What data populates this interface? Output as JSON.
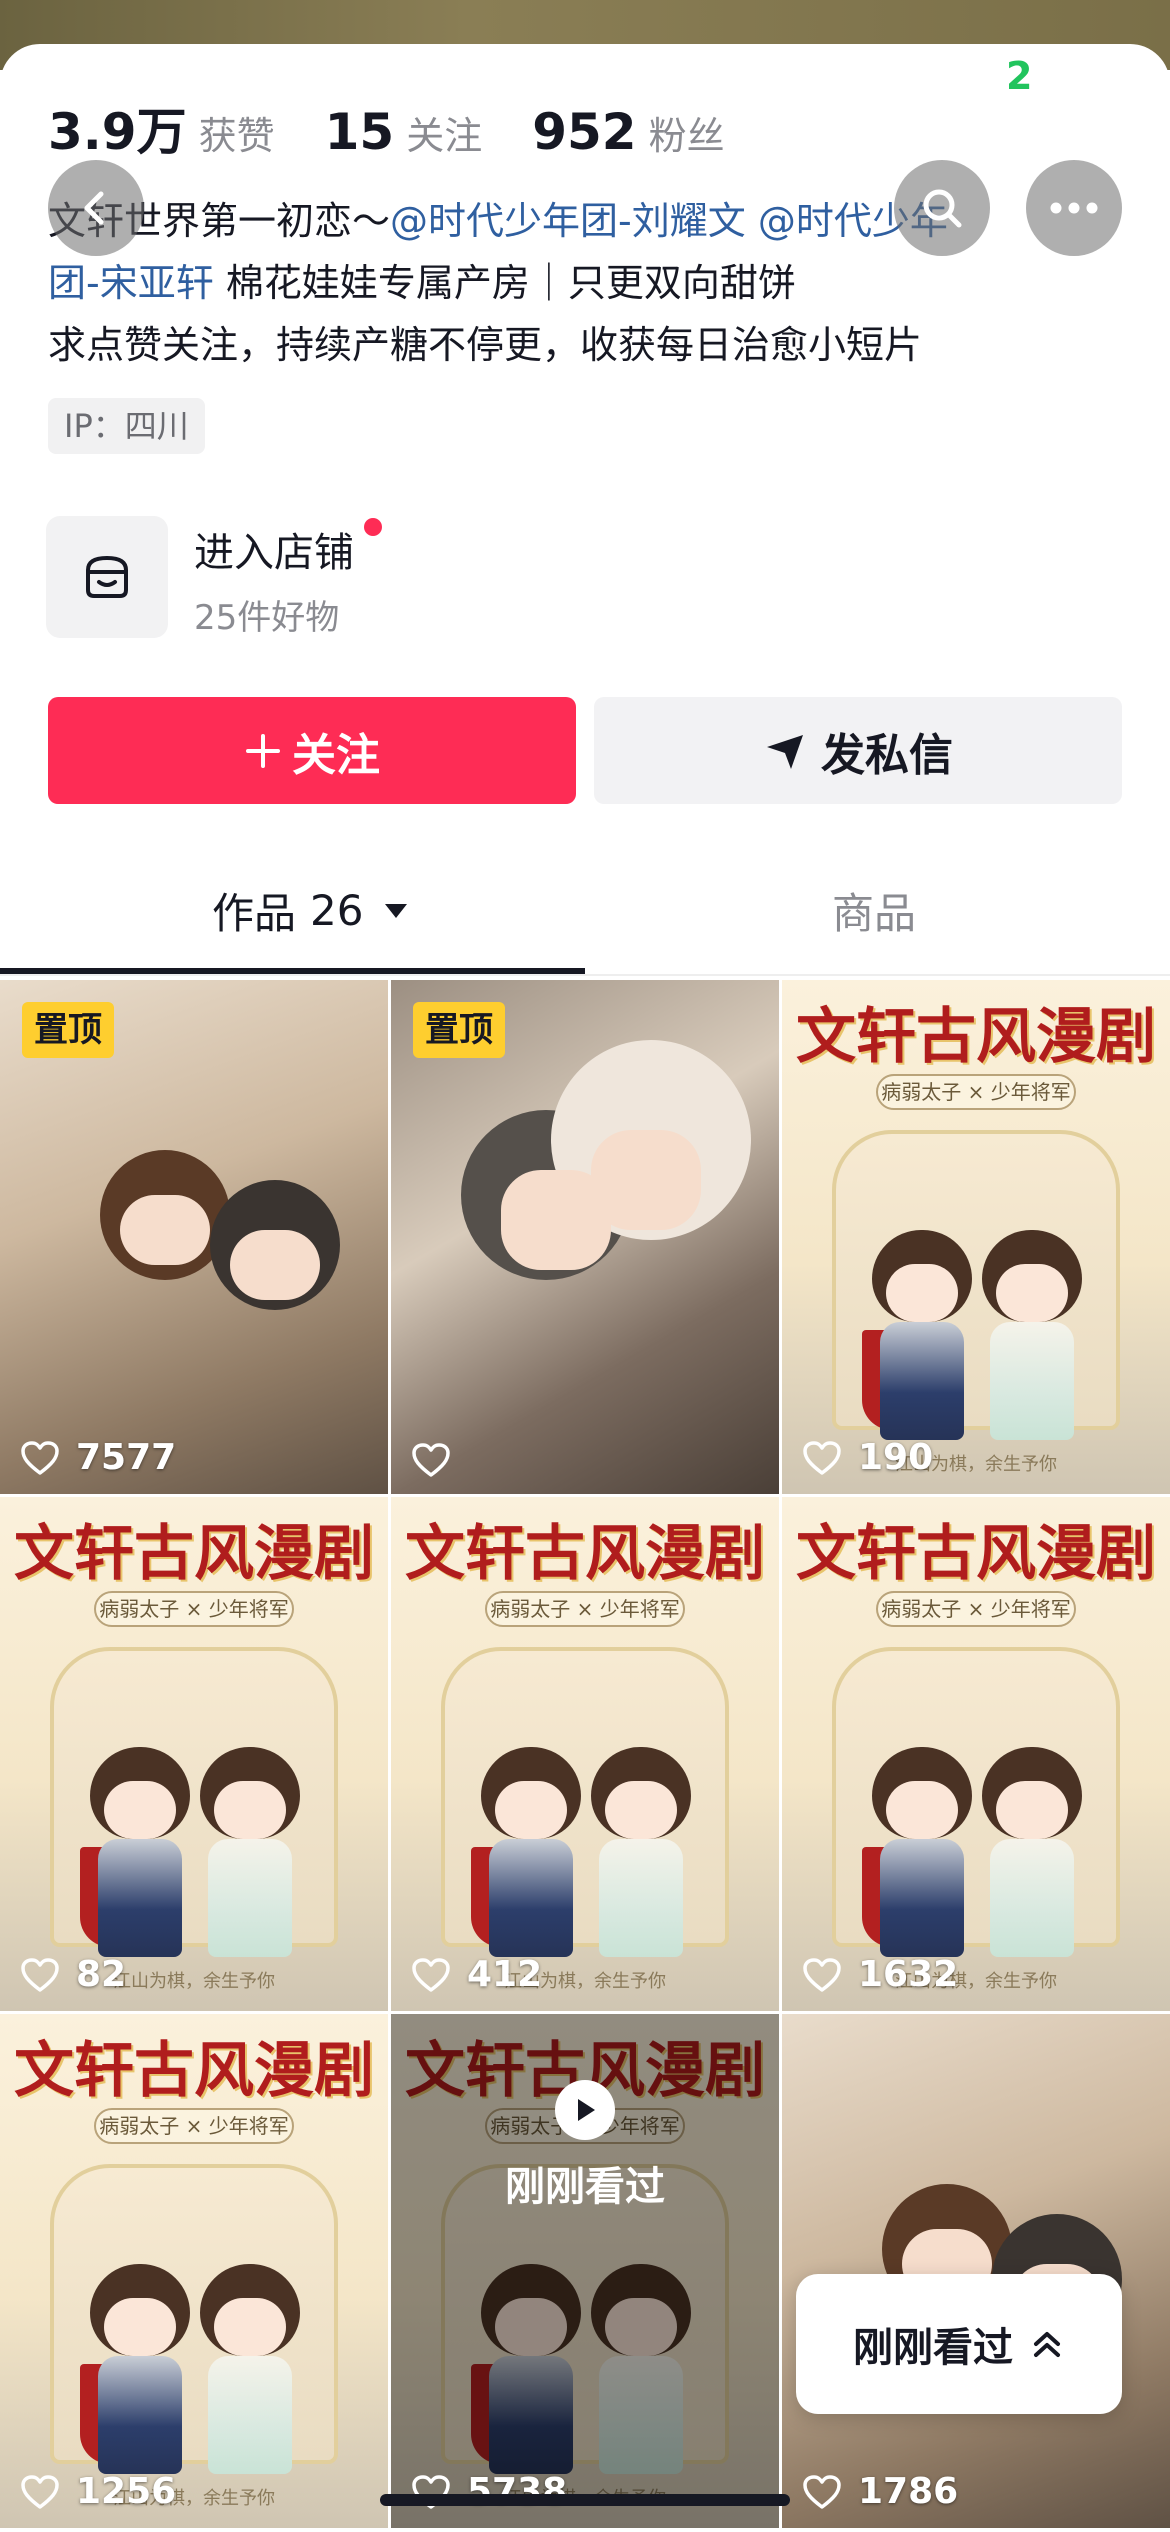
{
  "status": {
    "badge": "2"
  },
  "stats": [
    {
      "num": "3.9万",
      "label": "获赞"
    },
    {
      "num": "15",
      "label": "关注"
    },
    {
      "num": "952",
      "label": "粉丝"
    }
  ],
  "bio": {
    "line1_prefix": "文轩世界第一初恋～",
    "mention1": "@时代少年团-刘耀文",
    "mention2_a": "@时代少年",
    "mention2_b": "团-宋亚轩",
    "line2_rest": "棉花娃娃专属产房｜只更双向甜饼",
    "line3": "求点赞关注，持续产糖不停更，收获每日治愈小短片"
  },
  "ip": "IP：四川",
  "shop": {
    "title": "进入店铺",
    "subtitle": "25件好物"
  },
  "buttons": {
    "follow": "关注",
    "message": "发私信"
  },
  "tabs": {
    "works_label": "作品",
    "works_count": "26",
    "goods_label": "商品"
  },
  "poster": {
    "title": "文轩古风漫剧",
    "subtitle": "病弱太子 × 少年将军",
    "footer": "江山为棋，余生予你"
  },
  "pin_label": "置顶",
  "videos": [
    {
      "likes": "7577",
      "pinned": true,
      "kind": "bed"
    },
    {
      "likes": "",
      "pinned": true,
      "kind": "hug"
    },
    {
      "likes": "190",
      "pinned": false,
      "kind": "poster"
    },
    {
      "likes": "82",
      "pinned": false,
      "kind": "poster"
    },
    {
      "likes": "412",
      "pinned": false,
      "kind": "poster"
    },
    {
      "likes": "1632",
      "pinned": false,
      "kind": "poster"
    },
    {
      "likes": "1256",
      "pinned": false,
      "kind": "poster"
    },
    {
      "likes": "5738",
      "pinned": false,
      "kind": "poster"
    },
    {
      "likes": "1786",
      "pinned": false,
      "kind": "bed"
    }
  ],
  "just_watched": "刚刚看过",
  "floating_button": "刚刚看过"
}
